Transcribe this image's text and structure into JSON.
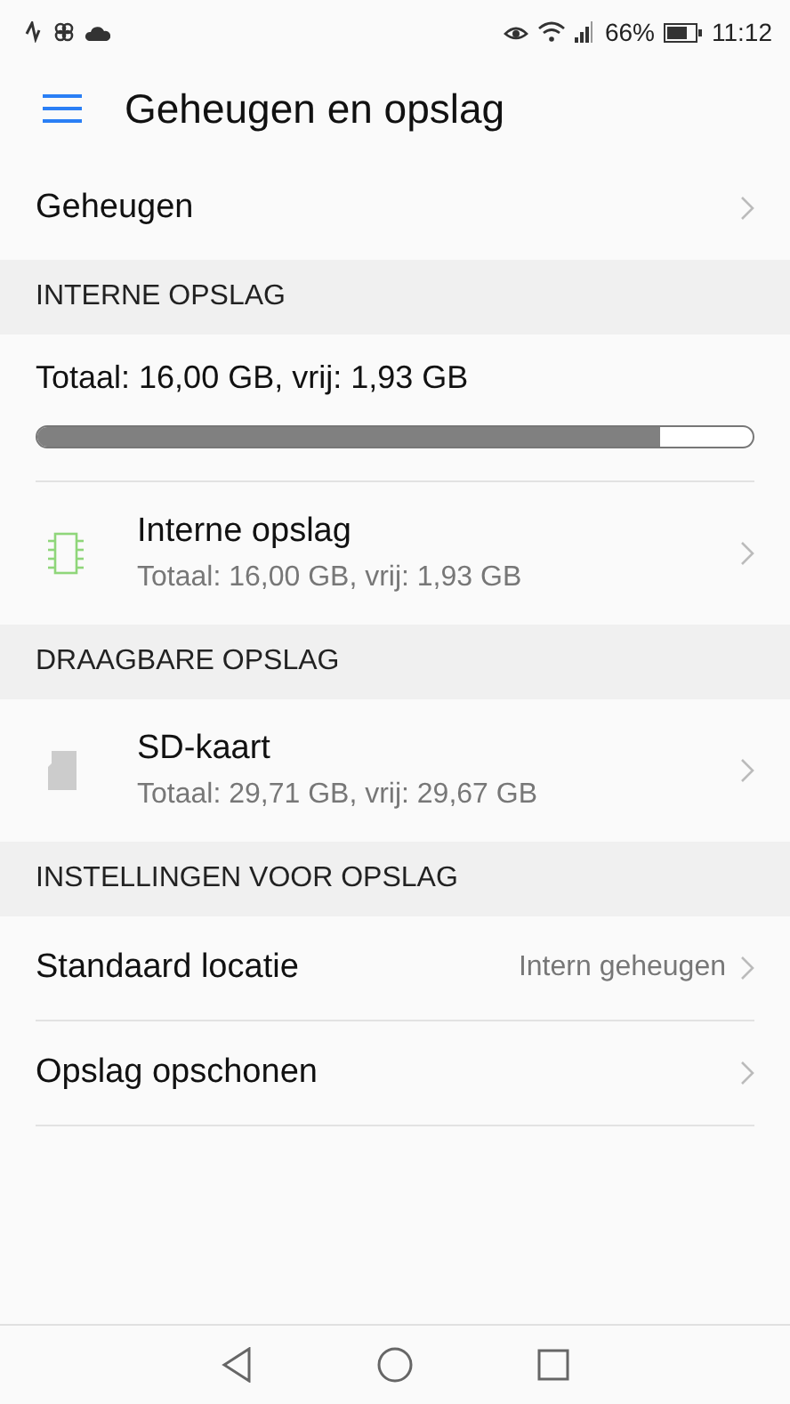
{
  "status_bar": {
    "battery": "66%",
    "time": "11:12"
  },
  "app_bar": {
    "title": "Geheugen en opslag"
  },
  "top_items": [
    {
      "label": "Geheugen"
    }
  ],
  "sections": [
    {
      "header": "INTERNE OPSLAG",
      "summary": {
        "text": "Totaal: 16,00 GB, vrij: 1,93 GB",
        "level": 0.87
      },
      "items": [
        {
          "kind": "internal",
          "color": "#8fd67a",
          "title": "Interne opslag",
          "subtitle": "Totaal: 16,00 GB, vrij: 1,93 GB"
        }
      ]
    },
    {
      "header": "DRAAGBARE OPSLAG",
      "items": [
        {
          "kind": "removable",
          "color": "#cccccc",
          "title": "SD-kaart",
          "subtitle": "Totaal: 29,71 GB, vrij: 29,67 GB"
        }
      ]
    },
    {
      "header": "INSTELLINGEN VOOR OPSLAG",
      "items": [
        {
          "kind": "value",
          "title": "Standaard locatie",
          "value": "Intern geheugen"
        },
        {
          "kind": "link",
          "title": "Opslag opschonen"
        }
      ]
    }
  ]
}
